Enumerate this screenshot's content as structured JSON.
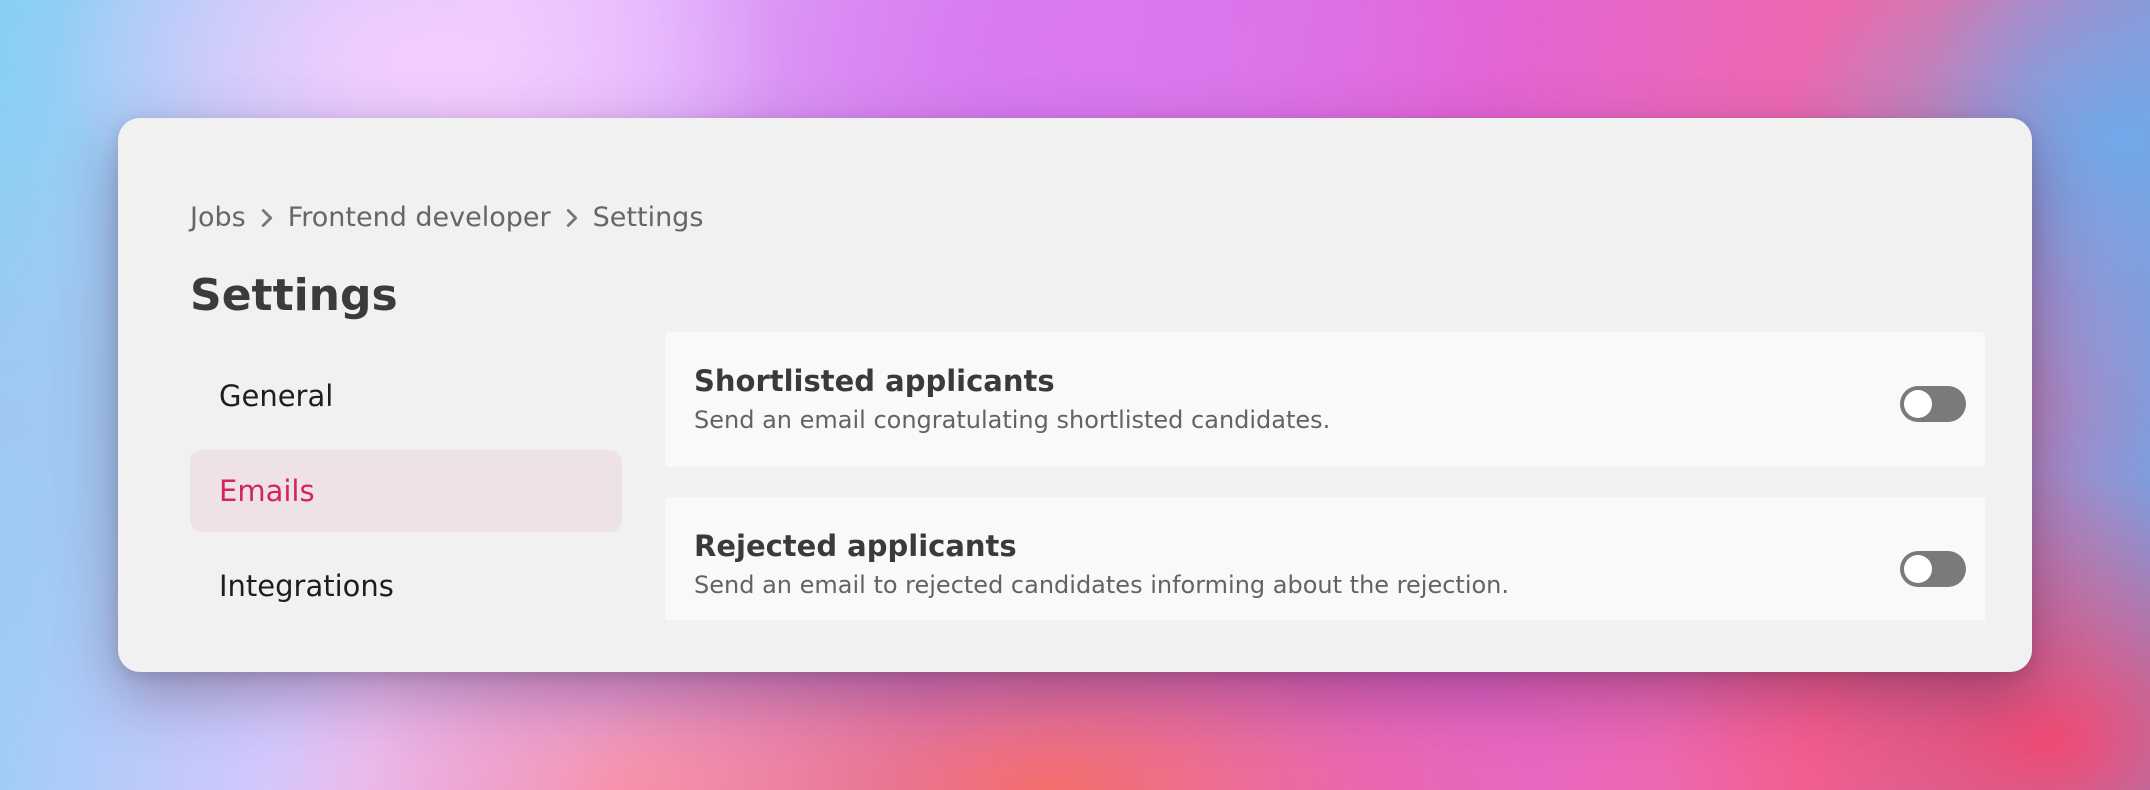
{
  "breadcrumb": {
    "items": [
      "Jobs",
      "Frontend developer",
      "Settings"
    ]
  },
  "page": {
    "title": "Settings"
  },
  "nav": {
    "items": [
      {
        "label": "General",
        "active": false
      },
      {
        "label": "Emails",
        "active": true
      },
      {
        "label": "Integrations",
        "active": false
      }
    ]
  },
  "settings": [
    {
      "title": "Shortlisted applicants",
      "description": "Send an email congratulating shortlisted candidates.",
      "enabled": false
    },
    {
      "title": "Rejected applicants",
      "description": "Send an email to rejected candidates informing about the rejection.",
      "enabled": false
    }
  ],
  "colors": {
    "accent": "#d42464",
    "active_nav_bg": "#efe2e4",
    "toggle_off": "#7a7a7a",
    "card_bg": "#f1f1f1"
  },
  "icons": {
    "breadcrumb_separator": "chevron-right-icon"
  }
}
